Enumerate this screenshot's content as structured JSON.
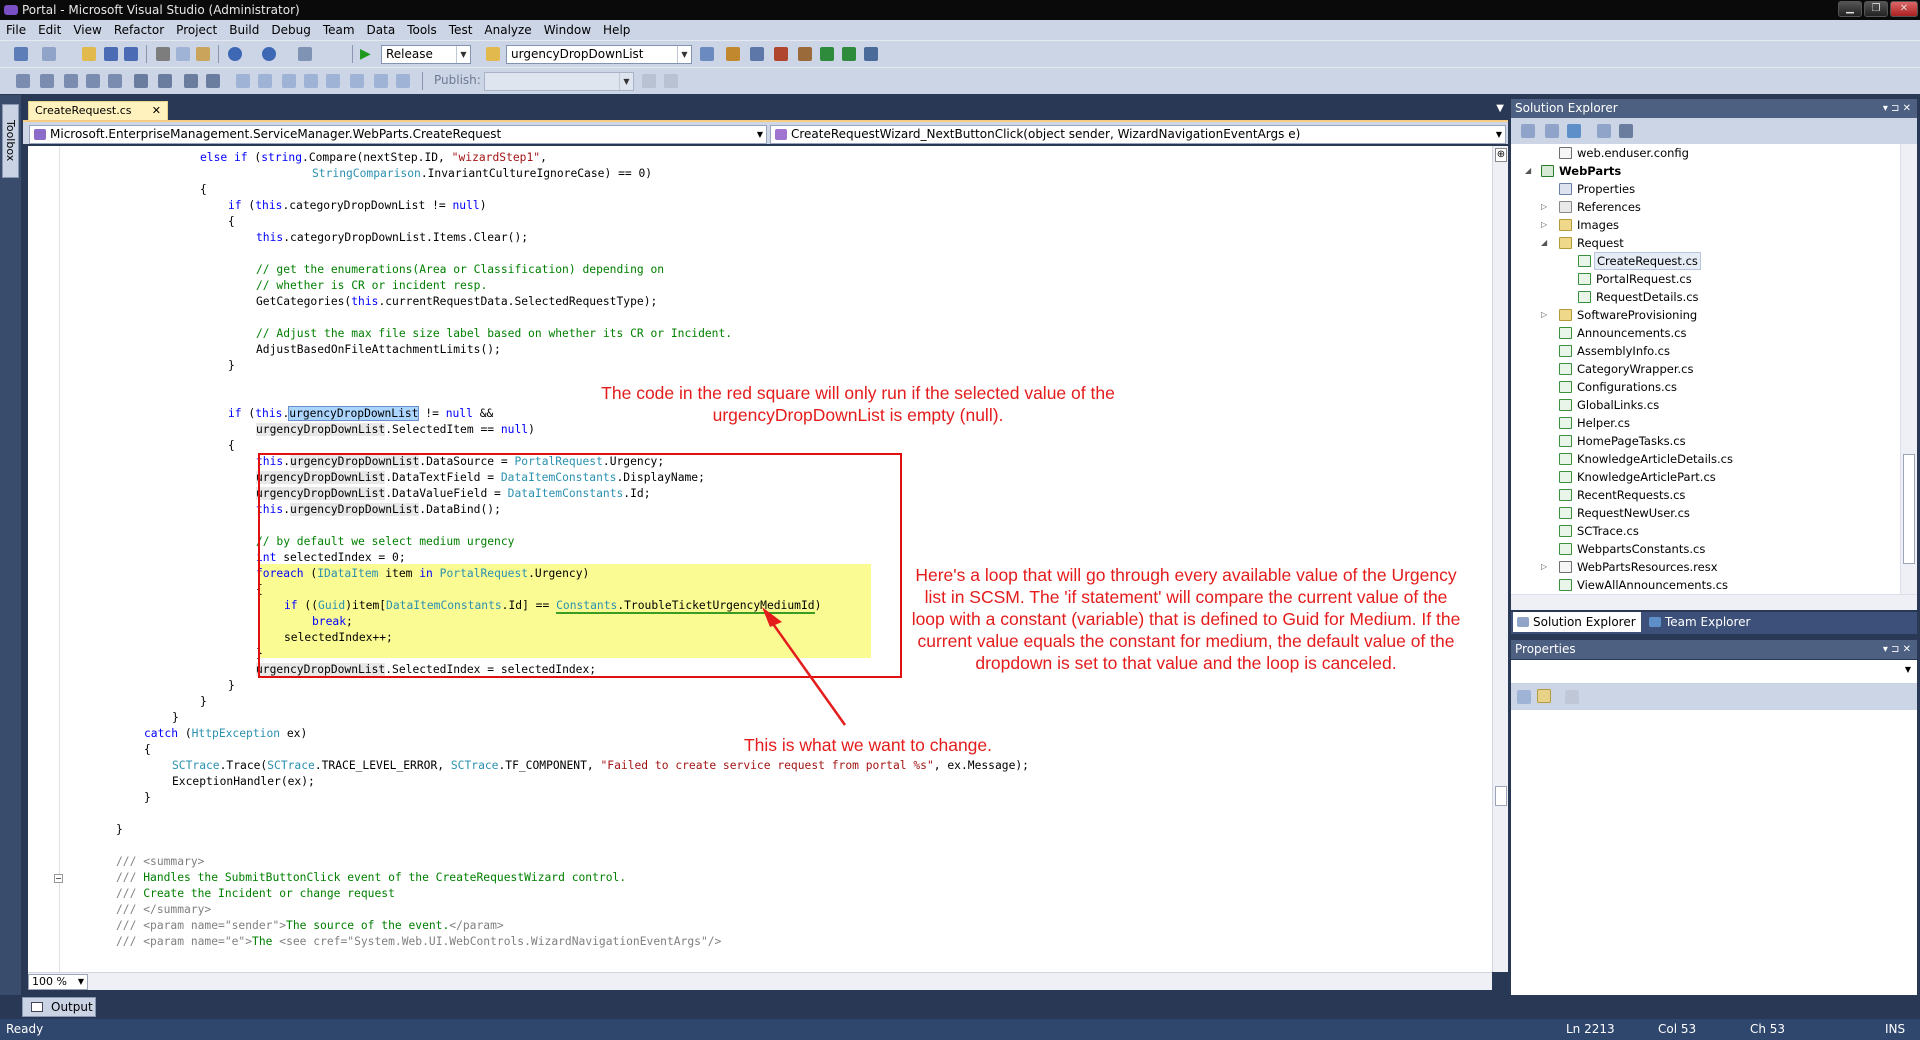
{
  "window": {
    "title": "Portal - Microsoft Visual Studio (Administrator)"
  },
  "menu": [
    "File",
    "Edit",
    "View",
    "Refactor",
    "Project",
    "Build",
    "Debug",
    "Team",
    "Data",
    "Tools",
    "Test",
    "Analyze",
    "Window",
    "Help"
  ],
  "toolbar": {
    "configuration": "Release",
    "find_combo": "urgencyDropDownList",
    "publish_label": "Publish:"
  },
  "toolbox_label": "Toolbox",
  "editor": {
    "tab_label": "CreateRequest.cs",
    "nav_class": "Microsoft.EnterpriseManagement.ServiceManager.WebParts.CreateRequest",
    "nav_member": "CreateRequestWizard_NextButtonClick(object sender, WizardNavigationEventArgs e)",
    "zoom": "100 %"
  },
  "annotations": {
    "top_line1": "The code in the red square will only run if the selected value of the",
    "top_line2": "urgencyDropDownList is empty (null).",
    "right_lines": [
      "Here's a loop that will go through every available value of the Urgency",
      "list in SCSM. The 'if statement' will compare the current value of the",
      "loop with a constant (variable) that is defined to Guid for Medium. If the",
      "current value equals the constant for medium, the default value of the",
      "dropdown is set to that value and the loop is canceled."
    ],
    "bottom": "This is what we want to change."
  },
  "solution_explorer": {
    "title": "Solution Explorer",
    "items": [
      {
        "label": "web.enduser.config"
      },
      {
        "label": "WebParts"
      },
      {
        "label": "Properties"
      },
      {
        "label": "References"
      },
      {
        "label": "Images"
      },
      {
        "label": "Request"
      },
      {
        "label": "CreateRequest.cs"
      },
      {
        "label": "PortalRequest.cs"
      },
      {
        "label": "RequestDetails.cs"
      },
      {
        "label": "SoftwareProvisioning"
      },
      {
        "label": "Announcements.cs"
      },
      {
        "label": "AssemblyInfo.cs"
      },
      {
        "label": "CategoryWrapper.cs"
      },
      {
        "label": "Configurations.cs"
      },
      {
        "label": "GlobalLinks.cs"
      },
      {
        "label": "Helper.cs"
      },
      {
        "label": "HomePageTasks.cs"
      },
      {
        "label": "KnowledgeArticleDetails.cs"
      },
      {
        "label": "KnowledgeArticlePart.cs"
      },
      {
        "label": "RecentRequests.cs"
      },
      {
        "label": "RequestNewUser.cs"
      },
      {
        "label": "SCTrace.cs"
      },
      {
        "label": "WebpartsConstants.cs"
      },
      {
        "label": "WebPartsResources.resx"
      },
      {
        "label": "ViewAllAnnouncements.cs"
      }
    ],
    "tabs": [
      "Solution Explorer",
      "Team Explorer"
    ]
  },
  "properties": {
    "title": "Properties"
  },
  "output_tab": "Output",
  "status": {
    "left": "Ready",
    "line": "Ln 2213",
    "col": "Col 53",
    "ch": "Ch 53",
    "mode": "INS"
  }
}
